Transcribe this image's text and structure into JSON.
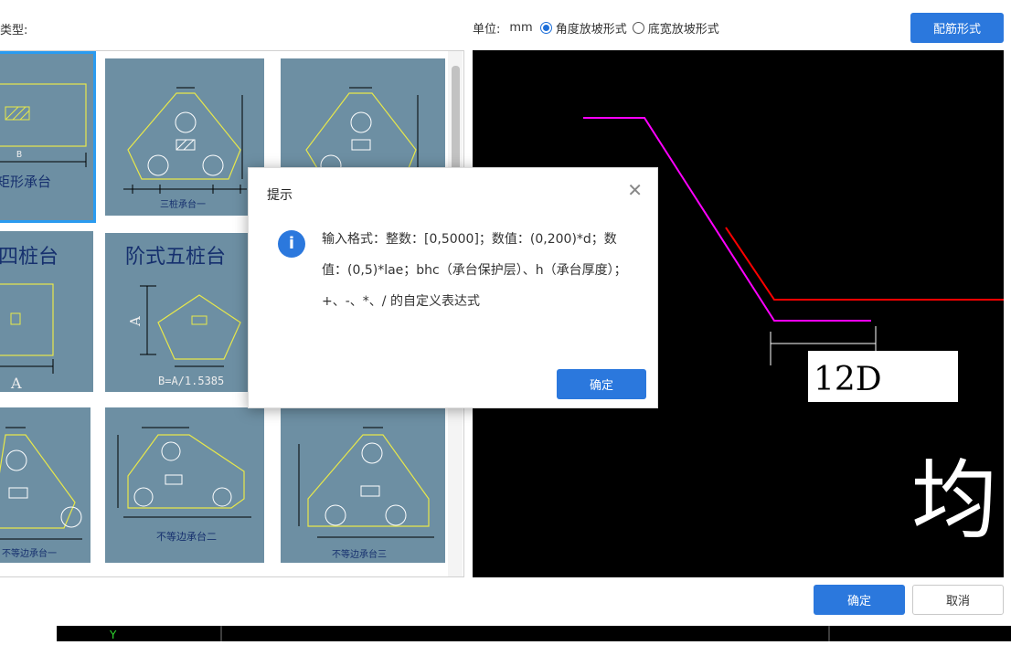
{
  "header": {
    "type_label": "类型:",
    "unit_label": "单位:",
    "unit_value": "mm",
    "radio_angle": "角度放坡形式",
    "radio_width": "底宽放坡形式",
    "rebar_button": "配筋形式"
  },
  "tiles": {
    "rect": {
      "name": "矩形承台",
      "dim": "B"
    },
    "three_pile_1": {
      "name": "三桩承台一"
    },
    "four_pile": {
      "name": "四桩台",
      "dim": "A"
    },
    "step_five": {
      "name": "阶式五桩台",
      "dim_a": "A",
      "formula": "B=A/1.5385"
    },
    "uneq_1": {
      "name": "不等边承台一"
    },
    "uneq_2": {
      "name": "不等边承台二"
    },
    "uneq_3": {
      "name": "不等边承台三"
    }
  },
  "preview": {
    "label": "12D",
    "big_char": "均",
    "colors": {
      "magenta": "#ff00ff",
      "red": "#ff0000"
    }
  },
  "dialog": {
    "title": "提示",
    "message": "输入格式：整数：[0,5000]；数值：(0,200)*d；数值：(0,5)*lae；bhc（承台保护层）、h（承台厚度）；+、-、*、/ 的自定义表达式",
    "ok": "确定",
    "icon": "info-icon"
  },
  "footer": {
    "ok": "确定",
    "cancel": "取消",
    "axis_label": "Y"
  }
}
